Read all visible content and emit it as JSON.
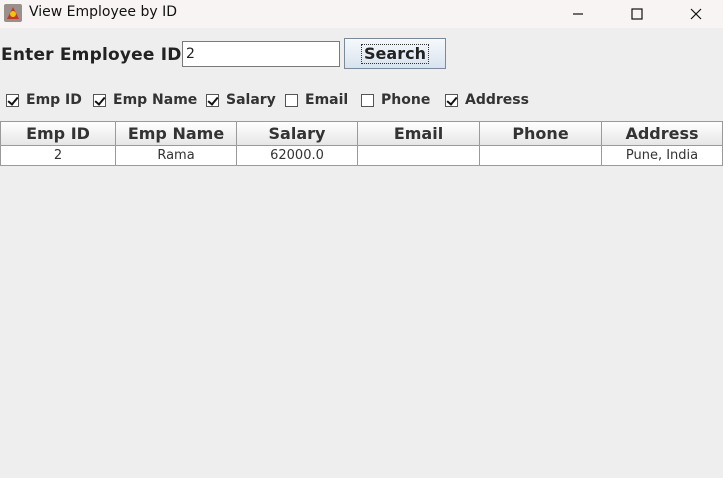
{
  "window": {
    "title": "View Employee by ID",
    "icons": {
      "app": "java-app-icon",
      "minimize": "minimize-icon",
      "maximize": "maximize-icon",
      "close": "close-icon"
    }
  },
  "search": {
    "label": "Enter Employee ID:",
    "value": "2",
    "button_label": "Search"
  },
  "columns_filter": [
    {
      "label": "Emp ID",
      "checked": true
    },
    {
      "label": "Emp Name",
      "checked": true
    },
    {
      "label": "Salary",
      "checked": true
    },
    {
      "label": "Email",
      "checked": false
    },
    {
      "label": "Phone",
      "checked": false
    },
    {
      "label": "Address",
      "checked": true
    }
  ],
  "table": {
    "headers": [
      "Emp ID",
      "Emp Name",
      "Salary",
      "Email",
      "Phone",
      "Address"
    ],
    "rows": [
      [
        "2",
        "Rama",
        "62000.0",
        "",
        "",
        "Pune, India"
      ]
    ]
  }
}
